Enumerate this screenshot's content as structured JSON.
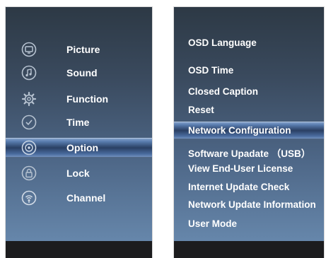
{
  "left_menu": {
    "items": [
      {
        "label": "Picture",
        "icon": "picture-icon",
        "selected": false
      },
      {
        "label": "Sound",
        "icon": "sound-icon",
        "selected": false
      },
      {
        "label": "Function",
        "icon": "function-icon",
        "selected": false
      },
      {
        "label": "Time",
        "icon": "time-icon",
        "selected": false
      },
      {
        "label": "Option",
        "icon": "option-icon",
        "selected": true
      },
      {
        "label": "Lock",
        "icon": "lock-icon",
        "selected": false
      },
      {
        "label": "Channel",
        "icon": "channel-icon",
        "selected": false
      }
    ]
  },
  "option_menu": {
    "items": [
      {
        "label": "OSD Language",
        "selected": false
      },
      {
        "label": "OSD Time",
        "selected": false
      },
      {
        "label": "Closed Caption",
        "selected": false
      },
      {
        "label": "Reset",
        "selected": false
      },
      {
        "label": "Network Configuration",
        "selected": true
      },
      {
        "label": "Software Upadate （USB）",
        "selected": false
      },
      {
        "label": "View End-User License",
        "selected": false
      },
      {
        "label": "Internet Update Check",
        "selected": false
      },
      {
        "label": "Network Update Information",
        "selected": false
      },
      {
        "label": "User Mode",
        "selected": false
      }
    ]
  },
  "colors": {
    "text": "#ffffff",
    "footer": "#1c1c1e",
    "panel_top": "#2d3945",
    "panel_bottom": "#6b8db2",
    "highlight": "#5a7eb0"
  }
}
